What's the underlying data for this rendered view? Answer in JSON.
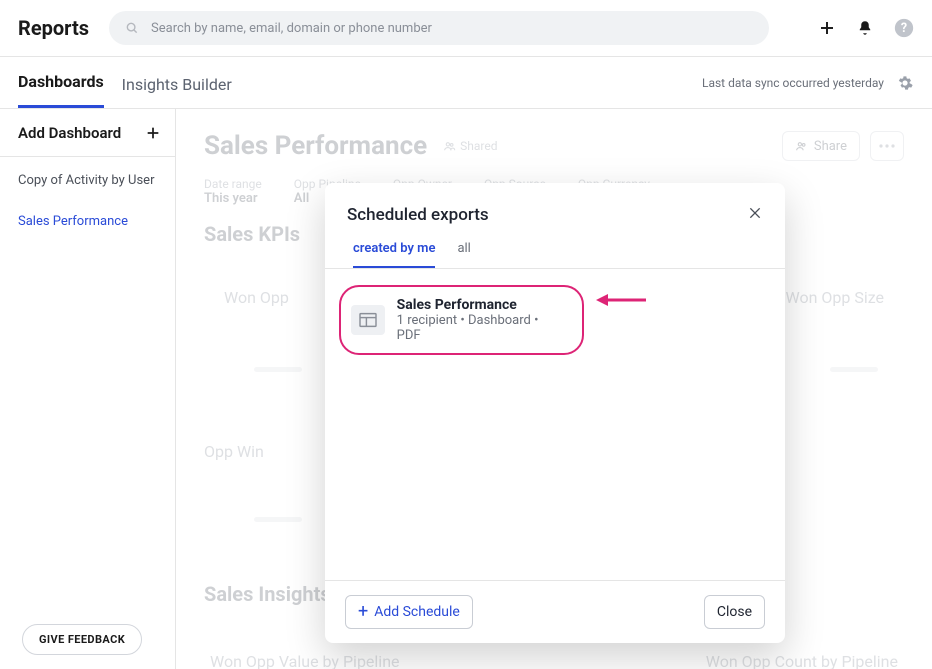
{
  "app_title": "Reports",
  "search_placeholder": "Search by name, email, domain or phone number",
  "subnav": {
    "tabs": [
      "Dashboards",
      "Insights Builder"
    ],
    "active": 0,
    "sync_text": "Last data sync occurred yesterday"
  },
  "sidebar": {
    "add_label": "Add Dashboard",
    "items": [
      {
        "label": "Copy of Activity by User"
      },
      {
        "label": "Sales Performance"
      }
    ],
    "active": 1
  },
  "page": {
    "title": "Sales Performance",
    "shared_label": "Shared",
    "share_btn": "Share",
    "filters": [
      {
        "label": "Date range",
        "value": "This year"
      },
      {
        "label": "Opp Pipeline",
        "value": "All"
      },
      {
        "label": "Opp Owner",
        "value": ""
      },
      {
        "label": "Opp Source",
        "value": ""
      },
      {
        "label": "Opp Currency",
        "value": ""
      }
    ],
    "section1": "Sales KPIs",
    "kpis": [
      "Won Opp",
      "Won Opp Size"
    ],
    "kpis2": [
      "Opp Win"
    ],
    "section2": "Sales Insights",
    "insights": [
      "Won Opp Value by Pipeline",
      "Won Opp Count by Pipeline"
    ]
  },
  "modal": {
    "title": "Scheduled exports",
    "tabs": [
      "created by me",
      "all"
    ],
    "active": 0,
    "item": {
      "title": "Sales Performance",
      "subtitle": "1 recipient • Dashboard • PDF"
    },
    "add_label": "Add Schedule",
    "close_label": "Close"
  },
  "feedback_label": "GIVE FEEDBACK"
}
